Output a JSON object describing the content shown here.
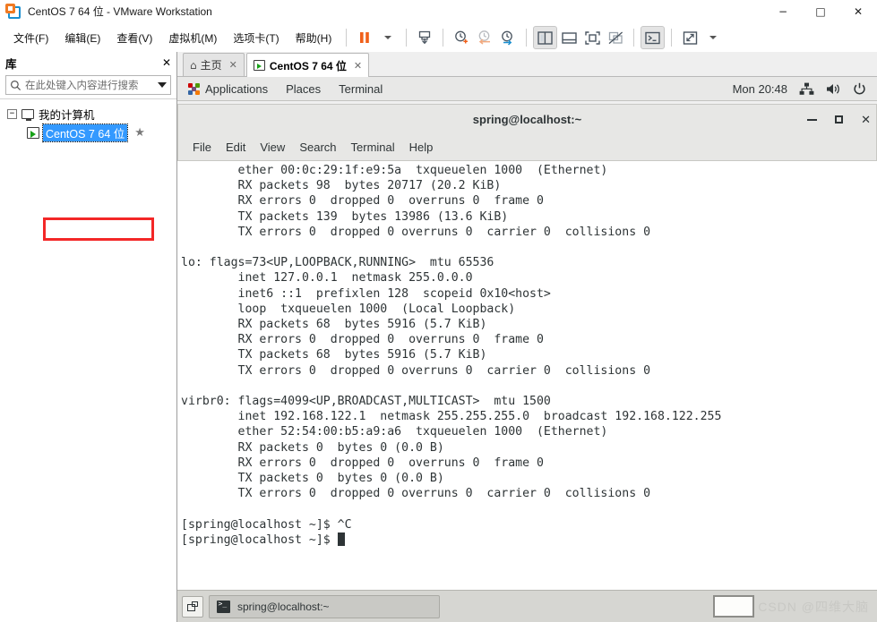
{
  "window": {
    "title": "CentOS 7 64 位 - VMware Workstation",
    "logo_icon": "vmware-logo-icon",
    "minimize": "−",
    "maximize": "□",
    "close": "✕"
  },
  "menubar": {
    "items": [
      {
        "label": "文件(F)",
        "name": "menu-file"
      },
      {
        "label": "编辑(E)",
        "name": "menu-edit"
      },
      {
        "label": "查看(V)",
        "name": "menu-view"
      },
      {
        "label": "虚拟机(M)",
        "name": "menu-vm"
      },
      {
        "label": "选项卡(T)",
        "name": "menu-tabs"
      },
      {
        "label": "帮助(H)",
        "name": "menu-help"
      }
    ]
  },
  "toolbar": {
    "buttons": [
      {
        "name": "pause-button",
        "icon": "pause-icon"
      },
      {
        "name": "power-dropdown",
        "icon": "chevron-down-icon"
      },
      {
        "name": "snapshot-button",
        "icon": "snapshot-icon"
      },
      {
        "name": "take-snapshot-button",
        "icon": "clock-plus-icon"
      },
      {
        "name": "revert-snapshot-button",
        "icon": "clock-back-icon"
      },
      {
        "name": "snapshot-manager-button",
        "icon": "clock-manage-icon"
      },
      {
        "name": "show-library-button",
        "icon": "sidebar-panel-icon"
      },
      {
        "name": "show-thumbnails-button",
        "icon": "thumbnail-bar-icon"
      },
      {
        "name": "fullscreen-button",
        "icon": "fullscreen-icon"
      },
      {
        "name": "unity-mode-button",
        "icon": "unity-mode-icon"
      },
      {
        "name": "console-view-button",
        "icon": "console-prompt-icon"
      },
      {
        "name": "stretch-guest-button",
        "icon": "stretch-arrows-icon"
      },
      {
        "name": "stretch-dropdown",
        "icon": "chevron-down-icon"
      }
    ]
  },
  "sidebar": {
    "title": "库",
    "close_label": "✕",
    "search": {
      "placeholder": "在此处键入内容进行搜索",
      "value": "",
      "icon": "search-icon",
      "dropdown_icon": "chevron-down-icon"
    },
    "tree": {
      "root": {
        "label": "我的计算机",
        "expander": "−",
        "icon": "monitor-icon"
      },
      "children": [
        {
          "label": "CentOS 7 64 位",
          "selected": true,
          "icon": "vm-icon",
          "favorite_icon": "★"
        }
      ]
    }
  },
  "tabs": [
    {
      "label": "主页",
      "icon": "home-icon",
      "close": "✕",
      "active": false,
      "name": "tab-home"
    },
    {
      "label": "CentOS 7 64 位",
      "icon": "vm-icon",
      "close": "✕",
      "active": true,
      "name": "tab-centos"
    }
  ],
  "guest": {
    "panel": {
      "applications": "Applications",
      "places": "Places",
      "terminal": "Terminal",
      "clock": "Mon 20:48",
      "network_icon": "network-icon",
      "volume_icon": "volume-icon",
      "power_icon": "power-icon"
    },
    "terminal_window": {
      "title": "spring@localhost:~",
      "menu": [
        "File",
        "Edit",
        "View",
        "Search",
        "Terminal",
        "Help"
      ],
      "minimize": "−",
      "maximize": "□",
      "close": "✕",
      "content": "        ether 00:0c:29:1f:e9:5a  txqueuelen 1000  (Ethernet)\n        RX packets 98  bytes 20717 (20.2 KiB)\n        RX errors 0  dropped 0  overruns 0  frame 0\n        TX packets 139  bytes 13986 (13.6 KiB)\n        TX errors 0  dropped 0 overruns 0  carrier 0  collisions 0\n\nlo: flags=73<UP,LOOPBACK,RUNNING>  mtu 65536\n        inet 127.0.0.1  netmask 255.0.0.0\n        inet6 ::1  prefixlen 128  scopeid 0x10<host>\n        loop  txqueuelen 1000  (Local Loopback)\n        RX packets 68  bytes 5916 (5.7 KiB)\n        RX errors 0  dropped 0  overruns 0  frame 0\n        TX packets 68  bytes 5916 (5.7 KiB)\n        TX errors 0  dropped 0 overruns 0  carrier 0  collisions 0\n\nvirbr0: flags=4099<UP,BROADCAST,MULTICAST>  mtu 1500\n        inet 192.168.122.1  netmask 255.255.255.0  broadcast 192.168.122.255\n        ether 52:54:00:b5:a9:a6  txqueuelen 1000  (Ethernet)\n        RX packets 0  bytes 0 (0.0 B)\n        RX errors 0  dropped 0  overruns 0  frame 0\n        TX packets 0  bytes 0 (0.0 B)\n        TX errors 0  dropped 0 overruns 0  carrier 0  collisions 0\n\n[spring@localhost ~]$ ^C\n[spring@localhost ~]$ "
    },
    "taskbar": {
      "workspace_icon": "workspace-switcher-icon",
      "window_button": "spring@localhost:~",
      "window_icon": "terminal-icon",
      "watermark": "CSDN @四维大脑"
    }
  },
  "colors": {
    "accent_orange": "#f07a22",
    "accent_blue": "#1a8fd0",
    "selection_blue": "#3399ff",
    "annotation_red": "#f32727"
  }
}
